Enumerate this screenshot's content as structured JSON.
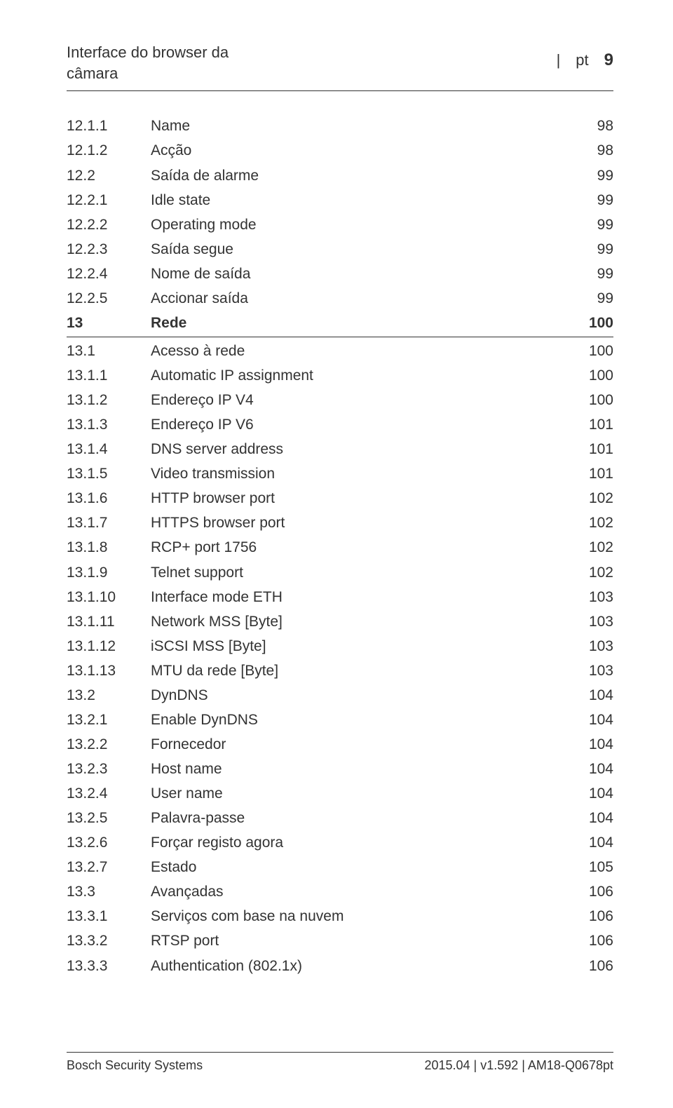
{
  "header": {
    "title_line1": "Interface do browser da",
    "title_line2": "câmara",
    "lang": "pt",
    "page_number": "9"
  },
  "toc": [
    {
      "num": "12.1.1",
      "title": "Name",
      "page": "98",
      "chapter": false
    },
    {
      "num": "12.1.2",
      "title": "Acção",
      "page": "98",
      "chapter": false
    },
    {
      "num": "12.2",
      "title": "Saída de alarme",
      "page": "99",
      "chapter": false
    },
    {
      "num": "12.2.1",
      "title": "Idle state",
      "page": "99",
      "chapter": false
    },
    {
      "num": "12.2.2",
      "title": "Operating mode",
      "page": "99",
      "chapter": false
    },
    {
      "num": "12.2.3",
      "title": "Saída segue",
      "page": "99",
      "chapter": false
    },
    {
      "num": "12.2.4",
      "title": "Nome de saída",
      "page": "99",
      "chapter": false
    },
    {
      "num": "12.2.5",
      "title": "Accionar saída",
      "page": "99",
      "chapter": false
    },
    {
      "num": "13",
      "title": "Rede",
      "page": "100",
      "chapter": true
    },
    {
      "num": "13.1",
      "title": "Acesso à rede",
      "page": "100",
      "chapter": false
    },
    {
      "num": "13.1.1",
      "title": "Automatic IP assignment",
      "page": "100",
      "chapter": false
    },
    {
      "num": "13.1.2",
      "title": "Endereço IP V4",
      "page": "100",
      "chapter": false
    },
    {
      "num": "13.1.3",
      "title": "Endereço IP V6",
      "page": "101",
      "chapter": false
    },
    {
      "num": "13.1.4",
      "title": "DNS server address",
      "page": "101",
      "chapter": false
    },
    {
      "num": "13.1.5",
      "title": "Video transmission",
      "page": "101",
      "chapter": false
    },
    {
      "num": "13.1.6",
      "title": "HTTP browser port",
      "page": "102",
      "chapter": false
    },
    {
      "num": "13.1.7",
      "title": "HTTPS browser port",
      "page": "102",
      "chapter": false
    },
    {
      "num": "13.1.8",
      "title": "RCP+ port 1756",
      "page": "102",
      "chapter": false
    },
    {
      "num": "13.1.9",
      "title": "Telnet support",
      "page": "102",
      "chapter": false
    },
    {
      "num": "13.1.10",
      "title": "Interface mode ETH",
      "page": "103",
      "chapter": false
    },
    {
      "num": "13.1.11",
      "title": "Network MSS [Byte]",
      "page": "103",
      "chapter": false
    },
    {
      "num": "13.1.12",
      "title": "iSCSI MSS [Byte]",
      "page": "103",
      "chapter": false
    },
    {
      "num": "13.1.13",
      "title": "MTU da rede [Byte]",
      "page": "103",
      "chapter": false
    },
    {
      "num": "13.2",
      "title": "DynDNS",
      "page": "104",
      "chapter": false
    },
    {
      "num": "13.2.1",
      "title": "Enable DynDNS",
      "page": "104",
      "chapter": false
    },
    {
      "num": "13.2.2",
      "title": "Fornecedor",
      "page": "104",
      "chapter": false
    },
    {
      "num": "13.2.3",
      "title": "Host name",
      "page": "104",
      "chapter": false
    },
    {
      "num": "13.2.4",
      "title": "User name",
      "page": "104",
      "chapter": false
    },
    {
      "num": "13.2.5",
      "title": "Palavra-passe",
      "page": "104",
      "chapter": false
    },
    {
      "num": "13.2.6",
      "title": "Forçar registo agora",
      "page": "104",
      "chapter": false
    },
    {
      "num": "13.2.7",
      "title": "Estado",
      "page": "105",
      "chapter": false
    },
    {
      "num": "13.3",
      "title": "Avançadas",
      "page": "106",
      "chapter": false
    },
    {
      "num": "13.3.1",
      "title": "Serviços com base na nuvem",
      "page": "106",
      "chapter": false
    },
    {
      "num": "13.3.2",
      "title": "RTSP port",
      "page": "106",
      "chapter": false
    },
    {
      "num": "13.3.3",
      "title": "Authentication (802.1x)",
      "page": "106",
      "chapter": false
    }
  ],
  "footer": {
    "left": "Bosch Security Systems",
    "right": "2015.04 | v1.592 | AM18-Q0678pt"
  }
}
